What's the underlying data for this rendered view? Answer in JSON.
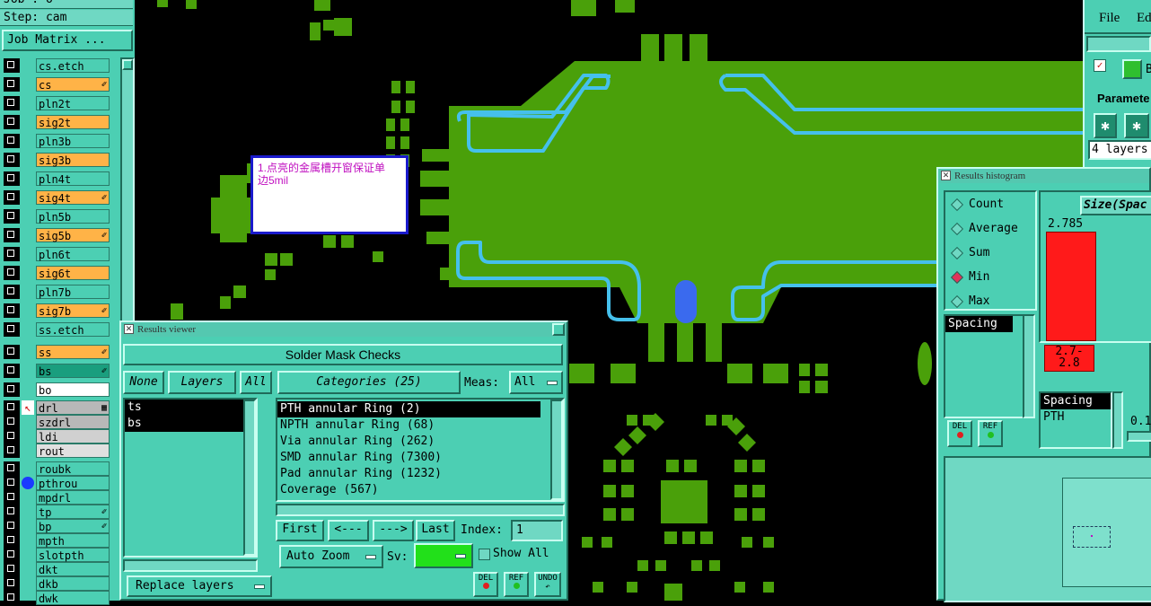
{
  "left_panel": {
    "job": "Job : o",
    "step": "Step: cam",
    "job_matrix_button": "Job Matrix ...",
    "layers": [
      {
        "name": "cs.etch",
        "color": "#4ccfb3",
        "mark": ""
      },
      {
        "name": "cs",
        "color": "#ffb347",
        "mark": "✐"
      },
      {
        "name": "pln2t",
        "color": "#4ccfb3",
        "mark": ""
      },
      {
        "name": "sig2t",
        "color": "#ffb347",
        "mark": ""
      },
      {
        "name": "pln3b",
        "color": "#4ccfb3",
        "mark": ""
      },
      {
        "name": "sig3b",
        "color": "#ffb347",
        "mark": ""
      },
      {
        "name": "pln4t",
        "color": "#4ccfb3",
        "mark": ""
      },
      {
        "name": "sig4t",
        "color": "#ffb347",
        "mark": "✐"
      },
      {
        "name": "pln5b",
        "color": "#4ccfb3",
        "mark": ""
      },
      {
        "name": "sig5b",
        "color": "#ffb347",
        "mark": "✐"
      },
      {
        "name": "pln6t",
        "color": "#4ccfb3",
        "mark": ""
      },
      {
        "name": "sig6t",
        "color": "#ffb347",
        "mark": ""
      },
      {
        "name": "pln7b",
        "color": "#4ccfb3",
        "mark": ""
      },
      {
        "name": "sig7b",
        "color": "#ffb347",
        "mark": "✐"
      },
      {
        "name": "ss.etch",
        "color": "#4ccfb3",
        "mark": ""
      },
      {
        "name": "ss",
        "color": "#ffb347",
        "mark": "✐"
      },
      {
        "name": "bs",
        "color": "#1a9e7e",
        "mark": "✐"
      },
      {
        "name": "bo",
        "color": "#ffffff",
        "mark": ""
      },
      {
        "name": "drl",
        "color": "#b8b8b8",
        "mark": "▦"
      },
      {
        "name": "szdrl",
        "color": "#b8b8b8",
        "mark": ""
      },
      {
        "name": "ldi",
        "color": "#d0d0d0",
        "mark": ""
      },
      {
        "name": "rout",
        "color": "#e0e0e0",
        "mark": ""
      },
      {
        "name": "roubk",
        "color": "#4ccfb3",
        "mark": ""
      },
      {
        "name": "pthrou",
        "color": "#4ccfb3",
        "mark": ""
      },
      {
        "name": "mpdrl",
        "color": "#4ccfb3",
        "mark": ""
      },
      {
        "name": "tp",
        "color": "#4ccfb3",
        "mark": "✐"
      },
      {
        "name": "bp",
        "color": "#4ccfb3",
        "mark": "✐"
      },
      {
        "name": "mpth",
        "color": "#4ccfb3",
        "mark": ""
      },
      {
        "name": "slotpth",
        "color": "#4ccfb3",
        "mark": ""
      },
      {
        "name": "dkt",
        "color": "#4ccfb3",
        "mark": ""
      },
      {
        "name": "dkb",
        "color": "#4ccfb3",
        "mark": ""
      },
      {
        "name": "dwk",
        "color": "#4ccfb3",
        "mark": ""
      }
    ]
  },
  "note": {
    "line1": "1.点亮的金属槽开窗保证单",
    "line2": "边5mil"
  },
  "results_viewer": {
    "title": "Results viewer",
    "header": "Solder Mask Checks",
    "none_btn": "None",
    "layers_btn": "Layers",
    "all_btn": "All",
    "categories_btn": "Categories (25)",
    "meas_label": "Meas:",
    "meas_value": "All",
    "layers_list": [
      "ts",
      "bs"
    ],
    "categories_list": [
      "PTH annular Ring (2)",
      "NPTH annular Ring (68)",
      "Via annular Ring (262)",
      "SMD annular Ring (7300)",
      "Pad annular Ring (1232)",
      "Coverage (567)"
    ],
    "first_btn": "First",
    "prev_btn": "<---",
    "next_btn": "--->",
    "last_btn": "Last",
    "index_label": "Index:",
    "index_value": "1",
    "auto_zoom": "Auto Zoom",
    "sv_label": "Sv:",
    "show_all": "Show All",
    "replace_layers": "Replace layers",
    "del_label": "DEL",
    "ref_label": "REF",
    "undo_label": "UNDO",
    "sv_color": "#22e01a"
  },
  "top_right": {
    "file_menu": "File",
    "edit_menu": "Ed",
    "param_label": "Paramete",
    "b_label": "B",
    "layers_info": "4 layers"
  },
  "histogram": {
    "title": "Results histogram",
    "options": [
      "Count",
      "Average",
      "Sum",
      "Min",
      "Max"
    ],
    "selected": "Min",
    "size_header": "Size(Spac",
    "bar_value": "2.785",
    "bar_range": "2.7-",
    "bar_range2": "2.8",
    "spacing_list": [
      "Spacing"
    ],
    "type_list": [
      "Spacing",
      "PTH"
    ],
    "small_value": "0.1",
    "del_label": "DEL",
    "ref_label": "REF",
    "bar_color": "#ff1a1a"
  }
}
